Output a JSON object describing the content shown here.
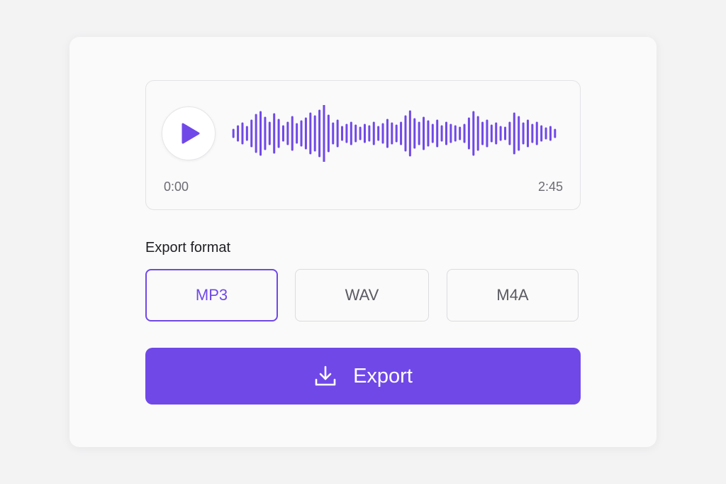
{
  "player": {
    "current_time": "0:00",
    "duration": "2:45",
    "play_icon": "play-icon"
  },
  "export_format": {
    "label": "Export format",
    "options": [
      {
        "label": "MP3",
        "selected": true
      },
      {
        "label": "WAV",
        "selected": false
      },
      {
        "label": "M4A",
        "selected": false
      }
    ]
  },
  "export_button": {
    "label": "Export",
    "icon": "download-icon"
  },
  "colors": {
    "accent": "#7048e8",
    "waveform": "#7048e8",
    "border": "#dcdce0",
    "text_muted": "#6b6b73"
  }
}
